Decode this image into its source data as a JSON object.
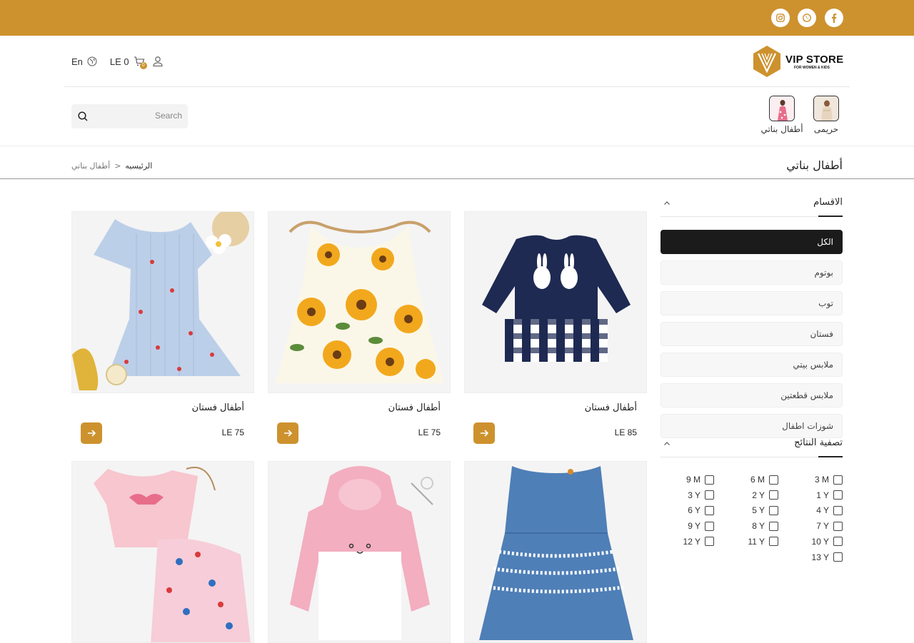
{
  "topbar": {
    "social": [
      "facebook-icon",
      "whatsapp-icon",
      "instagram-icon"
    ],
    "bg_color": "#cd922e"
  },
  "header": {
    "logo": {
      "brand": "VIP STORE",
      "tagline": "FOR WOMEN & KIDS"
    },
    "language": "En",
    "cart_total": "LE 0",
    "cart_count": "0"
  },
  "categories_nav": [
    {
      "label": "حريمى"
    },
    {
      "label": "أطفال بناتي"
    }
  ],
  "search": {
    "placeholder": "Search"
  },
  "page": {
    "title": "أطفال بناتي",
    "breadcrumb": {
      "home": "الرئيسيه",
      "separator": "<",
      "current": "أطفال بناتي"
    }
  },
  "sidebar": {
    "sections_title": "الاقسام",
    "categories": [
      {
        "label": "الكل",
        "active": true
      },
      {
        "label": "بوتوم",
        "active": false
      },
      {
        "label": "توب",
        "active": false
      },
      {
        "label": "فستان",
        "active": false
      },
      {
        "label": "ملابس بيتي",
        "active": false
      },
      {
        "label": "ملابس قطعتين",
        "active": false
      },
      {
        "label": "شوزات اطفال",
        "active": false
      }
    ],
    "filter_title": "تصفية النتائج",
    "sizes": [
      "3 M",
      "6 M",
      "9 M",
      "1 Y",
      "2 Y",
      "3 Y",
      "4 Y",
      "5 Y",
      "6 Y",
      "7 Y",
      "8 Y",
      "9 Y",
      "10 Y",
      "11 Y",
      "12 Y",
      "13 Y"
    ]
  },
  "products": [
    {
      "name": "أطفال فستان",
      "price": "LE 85"
    },
    {
      "name": "أطفال فستان",
      "price": "LE 75"
    },
    {
      "name": "أطفال فستان",
      "price": "LE 75"
    },
    {
      "name": "",
      "price": ""
    },
    {
      "name": "",
      "price": ""
    },
    {
      "name": "",
      "price": ""
    }
  ],
  "colors": {
    "accent": "#cd922e",
    "active_category": "#1b1b1b"
  }
}
